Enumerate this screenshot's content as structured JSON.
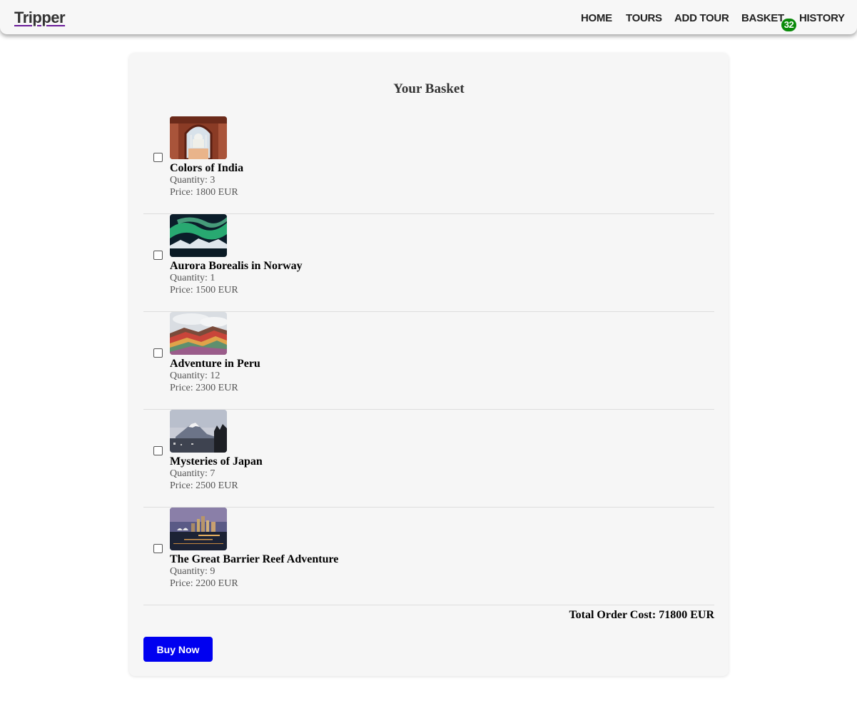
{
  "navbar": {
    "logo": "Tripper",
    "links": [
      {
        "label": "HOME"
      },
      {
        "label": "TOURS"
      },
      {
        "label": "ADD TOUR"
      },
      {
        "label": "BASKET"
      },
      {
        "label": "HISTORY"
      }
    ],
    "basket_count": "32"
  },
  "basket": {
    "title": "Your Basket",
    "quantity_label": "Quantity:",
    "price_label": "Price:",
    "items": [
      {
        "name": "Colors of India",
        "quantity": "3",
        "price": "1800 EUR",
        "image": "taj-mahal-arch"
      },
      {
        "name": "Aurora Borealis in Norway",
        "quantity": "1",
        "price": "1500 EUR",
        "image": "northern-lights"
      },
      {
        "name": "Adventure in Peru",
        "quantity": "12",
        "price": "2300 EUR",
        "image": "rainbow-mountain"
      },
      {
        "name": "Mysteries of Japan",
        "quantity": "7",
        "price": "2500 EUR",
        "image": "mount-fuji"
      },
      {
        "name": "The Great Barrier Reef Adventure",
        "quantity": "9",
        "price": "2200 EUR",
        "image": "sydney-harbour-night"
      }
    ],
    "total_label": "Total Order Cost:",
    "total_value": "71800 EUR",
    "buy_label": "Buy Now"
  },
  "colors": {
    "buy_button": "#0000f0",
    "badge": "#0a8a0a",
    "logo_underline": "#6a1b9a"
  }
}
